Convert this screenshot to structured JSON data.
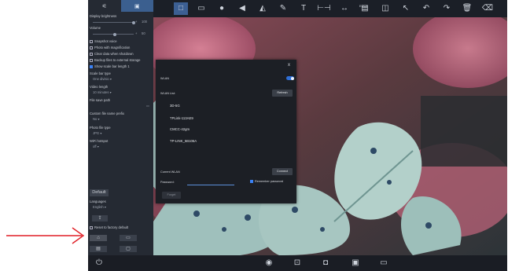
{
  "colors": {
    "accent": "#3b82f6",
    "annotation_arrow": "#e01f26",
    "panel_bg": "#252a33"
  },
  "panel": {
    "tabs": [
      {
        "icon": "sliders-icon"
      },
      {
        "icon": "camera-settings-icon"
      }
    ],
    "display_brightness_label": "Display brightness",
    "display_brightness_value": "100",
    "volume_label": "Volume",
    "volume_value": "50",
    "snapshot_voice": "Snapshot voice",
    "photo_magnification": "Photo with magnification",
    "clear_data": "Clear data when shutdown",
    "backup_files": "Backup files to external storage",
    "show_scale_bar": "Show scale bar length",
    "scale_bar_count": "1",
    "scale_bar_type_label": "Scale bar type",
    "scale_bar_type_value": "One divisio",
    "video_length_label": "Video length",
    "video_length_value": "10 minutes",
    "file_save_path_label": "File save path",
    "custom_name_prefix_label": "Custom file name prefix",
    "custom_name_prefix_value": "No",
    "photo_file_type_label": "Photo file type",
    "photo_file_type_value": "JPG",
    "wifi_hotspot_label": "WiFi hotspot",
    "wifi_hotspot_value": "off",
    "default_button": "Default",
    "languages_label": "Languages",
    "languages_value": "English",
    "reset_factory": "Reset to factory default"
  },
  "toolbar": {
    "tools": [
      "select-icon",
      "window-icon",
      "color-wheel-icon",
      "triangle-icon",
      "flip-icon",
      "pen-icon",
      "text-icon",
      "measure-icon",
      "arrow-measure-icon",
      "edof-icon",
      "compare-icon",
      "cursor-icon",
      "undo-icon",
      "redo-icon",
      "trash-icon",
      "eraser-icon"
    ],
    "edof_label": "EDOF",
    "text_label": "T"
  },
  "dialog": {
    "wlan_label": "WLAN",
    "wlan_list_label": "WLAN List:",
    "refresh_button": "Refresh",
    "networks": [
      "3D-5G",
      "TPLink-113AE9",
      "CMCC-42gm",
      "TP-LINK_5B106A"
    ],
    "current_wlan_label": "Current WLAN",
    "connect_button": "Connect",
    "password_label": "Password:",
    "password_value": "",
    "remember_password": "Remember password",
    "remember_checked": true,
    "forget_button": "Forget",
    "close_label": "x",
    "wlan_enabled": true
  },
  "bottombar": {
    "power_icon": "power-icon",
    "icons": [
      "camera-icon",
      "snapshot-icon",
      "video-icon",
      "record-icon",
      "folder-icon"
    ]
  }
}
